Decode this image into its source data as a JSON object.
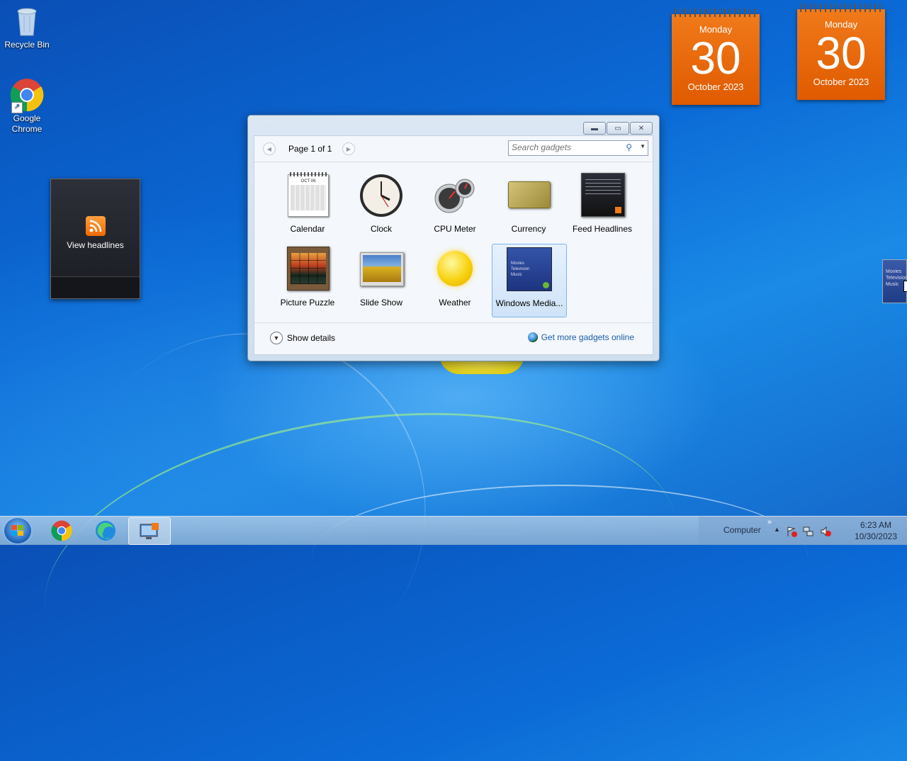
{
  "desktop": {
    "icons": [
      {
        "label": "Recycle Bin",
        "icon": "recycle-bin-icon"
      },
      {
        "label": "Google Chrome",
        "icon": "chrome-icon"
      }
    ]
  },
  "calendar_gadgets": [
    {
      "weekday": "Monday",
      "day": "30",
      "month_year": "October 2023"
    },
    {
      "weekday": "Monday",
      "day": "30",
      "month_year": "October 2023"
    }
  ],
  "feed_gadget": {
    "label": "View headlines",
    "icon": "rss-icon"
  },
  "gallery": {
    "page_label": "Page 1 of 1",
    "search_placeholder": "Search gadgets",
    "gadgets": [
      {
        "label": "Calendar",
        "icon": "calendar-icon"
      },
      {
        "label": "Clock",
        "icon": "clock-icon"
      },
      {
        "label": "CPU Meter",
        "icon": "cpu-meter-icon"
      },
      {
        "label": "Currency",
        "icon": "currency-icon"
      },
      {
        "label": "Feed Headlines",
        "icon": "feed-headlines-icon"
      },
      {
        "label": "Picture Puzzle",
        "icon": "picture-puzzle-icon"
      },
      {
        "label": "Slide Show",
        "icon": "slide-show-icon"
      },
      {
        "label": "Weather",
        "icon": "weather-icon"
      },
      {
        "label": "Windows Media...",
        "icon": "windows-media-center-icon",
        "selected": true
      }
    ],
    "calendar_thumb_month": "OCT 06",
    "media_thumb_lines": [
      "Movies",
      "Television",
      "Music"
    ],
    "show_details": "Show details",
    "get_more": "Get more gadgets online"
  },
  "drag_ghost_lines": [
    "Movies",
    "Television",
    "Music"
  ],
  "taskbar": {
    "items": [
      "start-button",
      "chrome-icon",
      "edge-icon",
      "gadgets-icon"
    ],
    "tray_label": "Computer",
    "time": "6:23 AM",
    "date": "10/30/2023"
  },
  "colors": {
    "calendar_orange": "#e96a0c",
    "selection": "#cfe3f8",
    "link": "#1a5fa8"
  }
}
